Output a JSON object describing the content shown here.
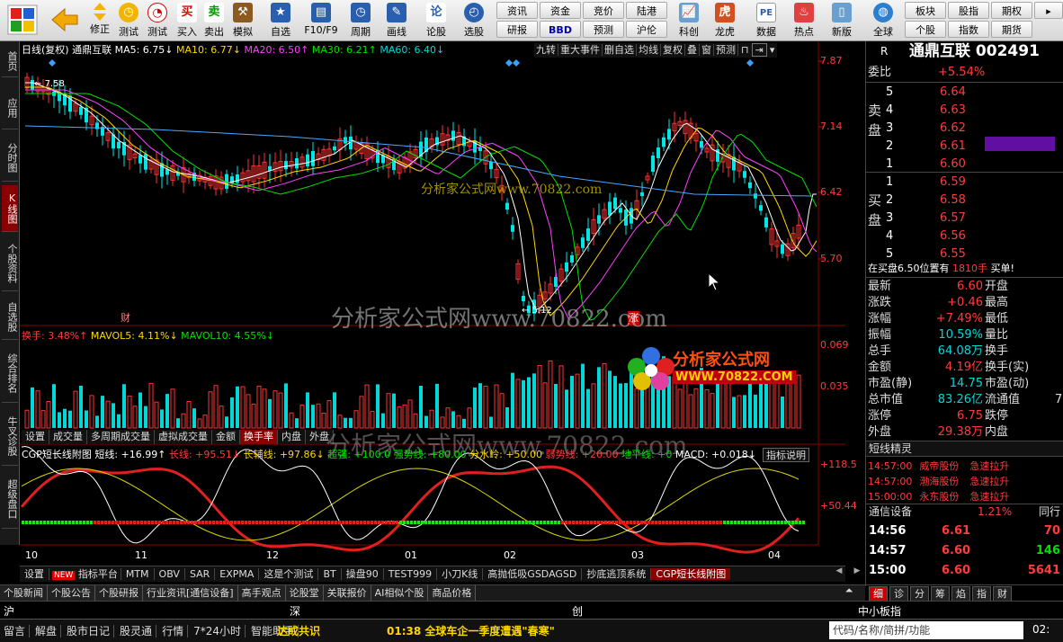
{
  "toolbar": {
    "big_buttons": [
      {
        "id": "modify",
        "label": "修正",
        "color": "#f2b400"
      },
      {
        "id": "backtest",
        "label": "测试",
        "color": "#c03030"
      },
      {
        "id": "buy",
        "label": "买入",
        "color": "#d00000",
        "glyph": "买"
      },
      {
        "id": "sell",
        "label": "卖出",
        "color": "#009000",
        "glyph": "卖"
      },
      {
        "id": "simulate",
        "label": "模拟",
        "color": "#8a5a20"
      },
      {
        "id": "watchlist",
        "label": "自选",
        "color": "#2a5fb0"
      },
      {
        "id": "f10",
        "label": "F10/F9",
        "color": "#2a5fb0"
      },
      {
        "id": "period",
        "label": "周期",
        "color": "#2a5fb0"
      },
      {
        "id": "drawline",
        "label": "画线",
        "color": "#2a5fb0"
      },
      {
        "id": "lunstock",
        "label": "论股",
        "color": "#2a5fb0",
        "glyph": "论"
      },
      {
        "id": "pick",
        "label": "选股",
        "color": "#2a5fb0"
      }
    ],
    "small_buttons": [
      "资讯",
      "资金",
      "竞价",
      "陆港",
      "研报",
      "BBD",
      "预测",
      "沪伦"
    ],
    "right_buttons": [
      {
        "id": "kechuang",
        "label": "科创",
        "color": "#6aa0d0"
      },
      {
        "id": "longhu",
        "label": "龙虎",
        "color": "#d05020"
      },
      {
        "id": "data",
        "label": "数据",
        "color": "#6aa0d0",
        "glyph": "PE"
      },
      {
        "id": "hot",
        "label": "热点",
        "color": "#e04040"
      },
      {
        "id": "newsb",
        "label": "新版",
        "color": "#6aa0d0"
      },
      {
        "id": "global",
        "label": "全球",
        "color": "#2a7fd0"
      }
    ],
    "far_right": [
      "板块",
      "股指",
      "期权",
      "个股",
      "指数",
      "期货"
    ]
  },
  "side_tabs": [
    "首页",
    "应用",
    "分时图",
    "K线图",
    "个股资料",
    "自选股",
    "综合排名",
    "牛叉诊股",
    "超级盘口"
  ],
  "chart": {
    "header": {
      "mode": "日线(复权)",
      "name": "通鼎互联",
      "ma5": "MA5: 6.75↓",
      "ma10": "MA10: 6.77↓",
      "ma20": "MA20: 6.50↑",
      "ma30": "MA30: 6.21↑",
      "ma60": "MA60: 6.40↓"
    },
    "menu_tabs": [
      "九转",
      "重大事件",
      "删自选",
      "均线",
      "复权",
      "叠",
      "窗",
      "预测"
    ],
    "y_labels_main": [
      "7.87",
      "7.14",
      "6.42",
      "5.70"
    ],
    "high_label": "7.58",
    "low_label": "5.12",
    "markers": {
      "cai": "财",
      "zhang": "涨"
    },
    "vol_header": {
      "hs": "换手: 3.48%↑",
      "mavol5": "MAVOL5: 4.11%↓",
      "mavol10": "MAVOL10: 4.55%↓"
    },
    "vol_y": [
      "0.069",
      "0.035"
    ],
    "vol_tabs": [
      "设置",
      "成交量",
      "多周期成交量",
      "虚拟成交量",
      "金额",
      "换手率",
      "内盘",
      "外盘"
    ],
    "ind_header": {
      "name": "CGP短长线附图",
      "dx": "短线: +16.99↑",
      "cx": "长线: +95.51↓",
      "cf": "长辅线: +97.86↓",
      "cq": "超强: +100.0",
      "qs": "强势线: +80.00",
      "fs": "分水岭: +50.00",
      "rs": "弱势线: +20.00",
      "dp": "地平线: +0",
      "macd": "MACD: +0.018↓"
    },
    "ind_btn": "指标说明",
    "ind_y": [
      "+118.5",
      "+50.44"
    ],
    "x_labels": [
      "10",
      "11",
      "12",
      "01",
      "02",
      "03",
      "04"
    ],
    "bottom_tabs": [
      "设置",
      "指标平台",
      "MTM",
      "OBV",
      "SAR",
      "EXPMA",
      "这是个测试",
      "BT",
      "操盘90",
      "TEST999",
      "小刀K线",
      "高抛低吸GSDAGSD",
      "抄底逃顶系统",
      "CGP短长线附图"
    ],
    "new_badge": "NEW",
    "watermark_main": "分析家公式网www.70822.com",
    "watermark_small": "分析家公式网www.70822.com",
    "watermark_mid": "分析家公式网www.70822.com",
    "logo_title": "分析家公式网",
    "logo_url": "WWW.70822.COM"
  },
  "right": {
    "code_prefix": "R",
    "name": "通鼎互联",
    "code": "002491",
    "weibi_label": "委比",
    "weibi": "+5.54%",
    "sell_label": "卖盘",
    "buy_label": "买盘",
    "asks": [
      [
        "5",
        "6.64"
      ],
      [
        "4",
        "6.63"
      ],
      [
        "3",
        "6.62"
      ],
      [
        "2",
        "6.61"
      ],
      [
        "1",
        "6.60"
      ]
    ],
    "bids": [
      [
        "1",
        "6.59"
      ],
      [
        "2",
        "6.58"
      ],
      [
        "3",
        "6.57"
      ],
      [
        "4",
        "6.56"
      ],
      [
        "5",
        "6.55"
      ]
    ],
    "notice_pre": "在买盘6.50位置有",
    "notice_num": "1810手",
    "notice_suf": "买单!",
    "stats": [
      [
        "最新",
        "6.60",
        "开盘",
        ""
      ],
      [
        "涨跌",
        "+0.46",
        "最高",
        ""
      ],
      [
        "涨幅",
        "+7.49%",
        "最低",
        ""
      ],
      [
        "振幅",
        "10.59%",
        "量比",
        ""
      ],
      [
        "总手",
        "64.08万",
        "换手",
        ""
      ],
      [
        "金额",
        "4.19亿",
        "换手(实)",
        ""
      ],
      [
        "市盈(静)",
        "14.75",
        "市盈(动)",
        ""
      ],
      [
        "总市值",
        "83.26亿",
        "流通值",
        "7"
      ],
      [
        "涨停",
        "6.75",
        "跌停",
        ""
      ],
      [
        "外盘",
        "29.38万",
        "内盘",
        ""
      ]
    ],
    "jx_title": "短线精灵",
    "jx": [
      [
        "14:57:00",
        "威帝股份",
        "急速拉升"
      ],
      [
        "14:57:00",
        "渤海股份",
        "急速拉升"
      ],
      [
        "15:00:00",
        "永东股份",
        "急速拉升"
      ]
    ],
    "comm_label": "通信设备",
    "comm_val": "1.21%",
    "comm_extra": "同行",
    "ticks": [
      [
        "14:56",
        "6.61",
        "70"
      ],
      [
        "14:57",
        "6.60",
        "146"
      ],
      [
        "15:00",
        "6.60",
        "5641"
      ]
    ],
    "tabs": [
      "细",
      "诊",
      "分",
      "筹",
      "焰",
      "指",
      "财"
    ]
  },
  "strip1": [
    "个股新闻",
    "个股公告",
    "个股研报",
    "行业资讯[通信设备]",
    "高手观点",
    "论股堂",
    "关联报价",
    "AI相似个股",
    "商品价格"
  ],
  "strip2": {
    "sh": "沪",
    "sz": "深",
    "cy": "创",
    "zx": "中小板指"
  },
  "status": {
    "items": [
      "留言",
      "解盘",
      "股市日记",
      "股灵通",
      "行情",
      "7*24小时",
      "智能助手"
    ],
    "hl": "达成共识",
    "news_time": "01:38",
    "news": "全球车企一季度遭遇\"春寒\"",
    "search": "代码/名称/简拼/功能",
    "time": "02:"
  }
}
